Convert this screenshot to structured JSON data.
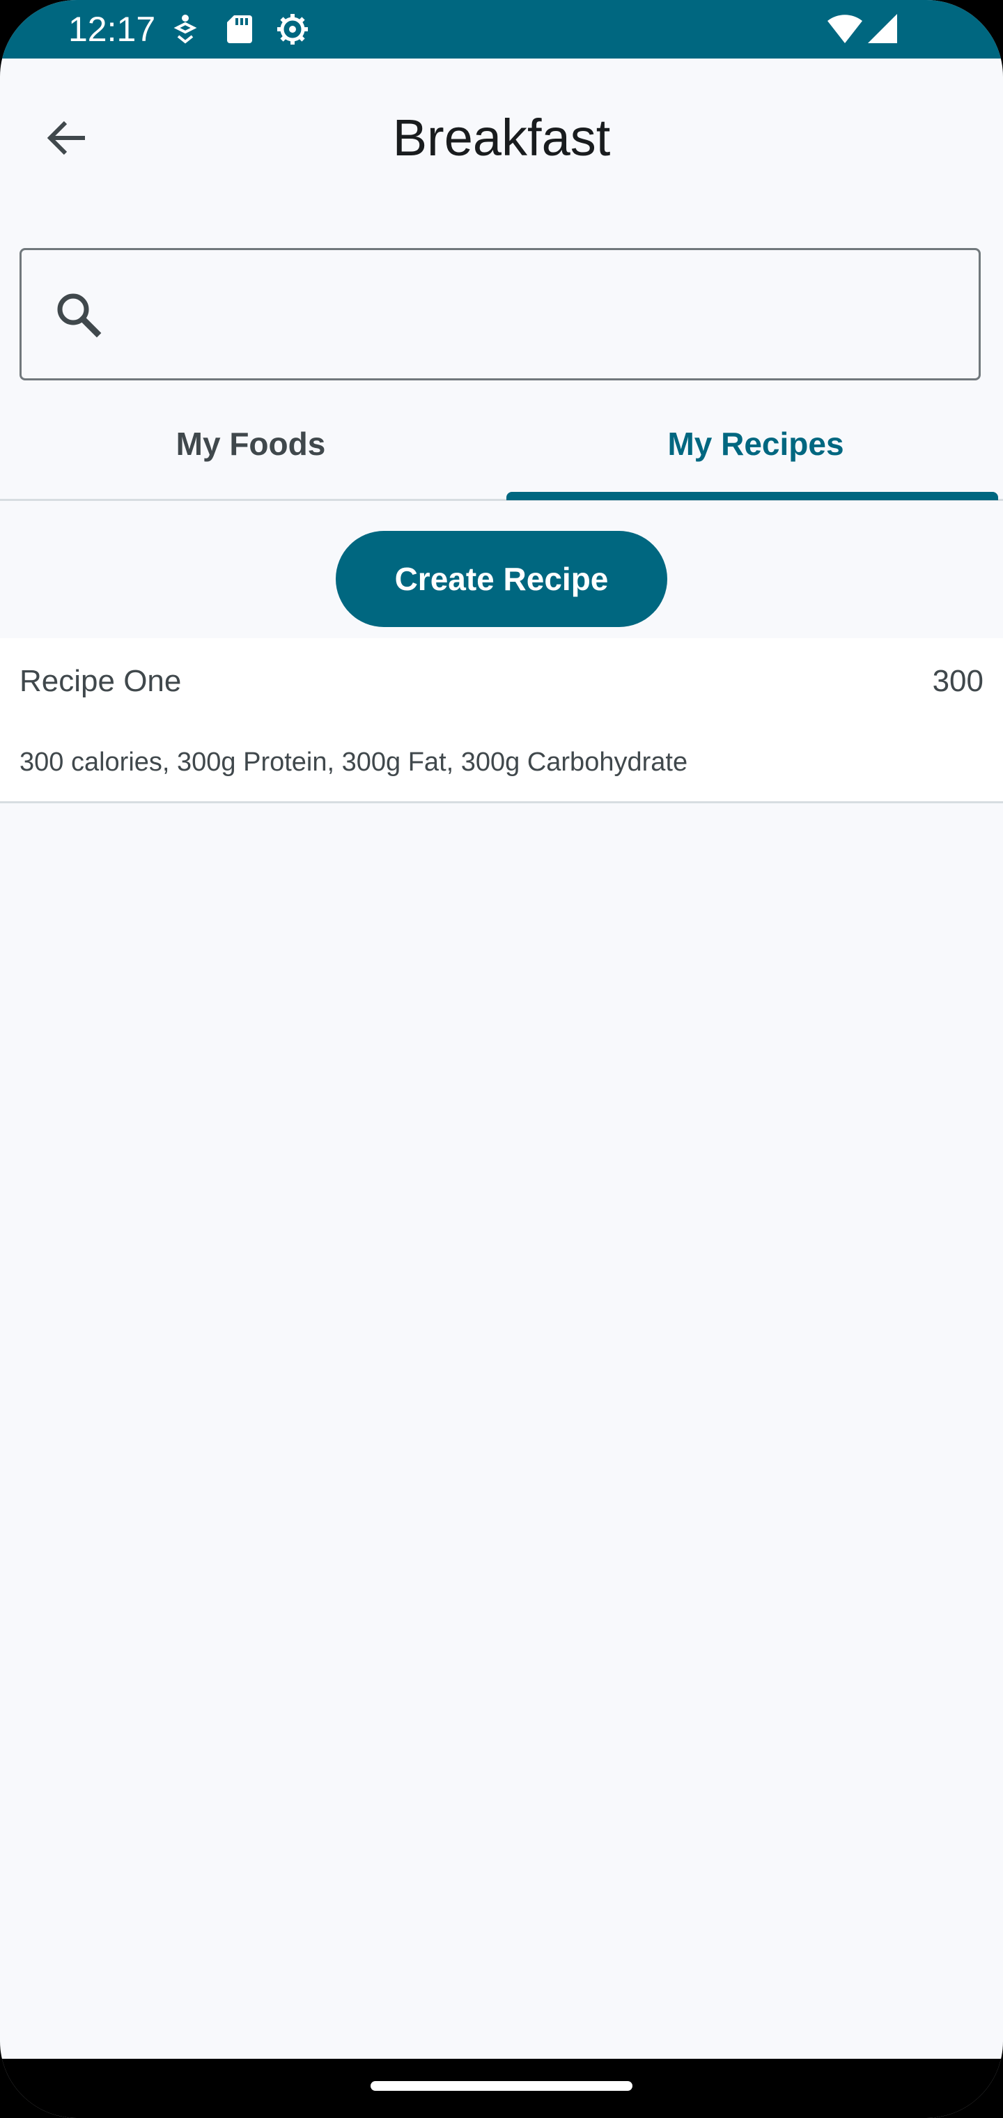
{
  "status_bar": {
    "time": "12:17",
    "icons": [
      "fitness-notification-icon",
      "sd-card-icon",
      "settings-gear-icon",
      "wifi-icon",
      "cell-signal-icon"
    ]
  },
  "header": {
    "title": "Breakfast",
    "back_icon": "arrow-back-icon"
  },
  "search": {
    "value": "",
    "placeholder": "",
    "icon": "search-icon"
  },
  "tabs": [
    {
      "label": "My Foods",
      "selected": false
    },
    {
      "label": "My Recipes",
      "selected": true
    }
  ],
  "create_button": {
    "label": "Create Recipe"
  },
  "recipes": [
    {
      "name": "Recipe One",
      "calories": "300",
      "macros": "300 calories, 300g Protein, 300g Fat, 300g Carbohydrate"
    }
  ],
  "colors": {
    "primary": "#006780",
    "background": "#f8f9fc",
    "text": "#40484c",
    "title": "#191c1e"
  }
}
